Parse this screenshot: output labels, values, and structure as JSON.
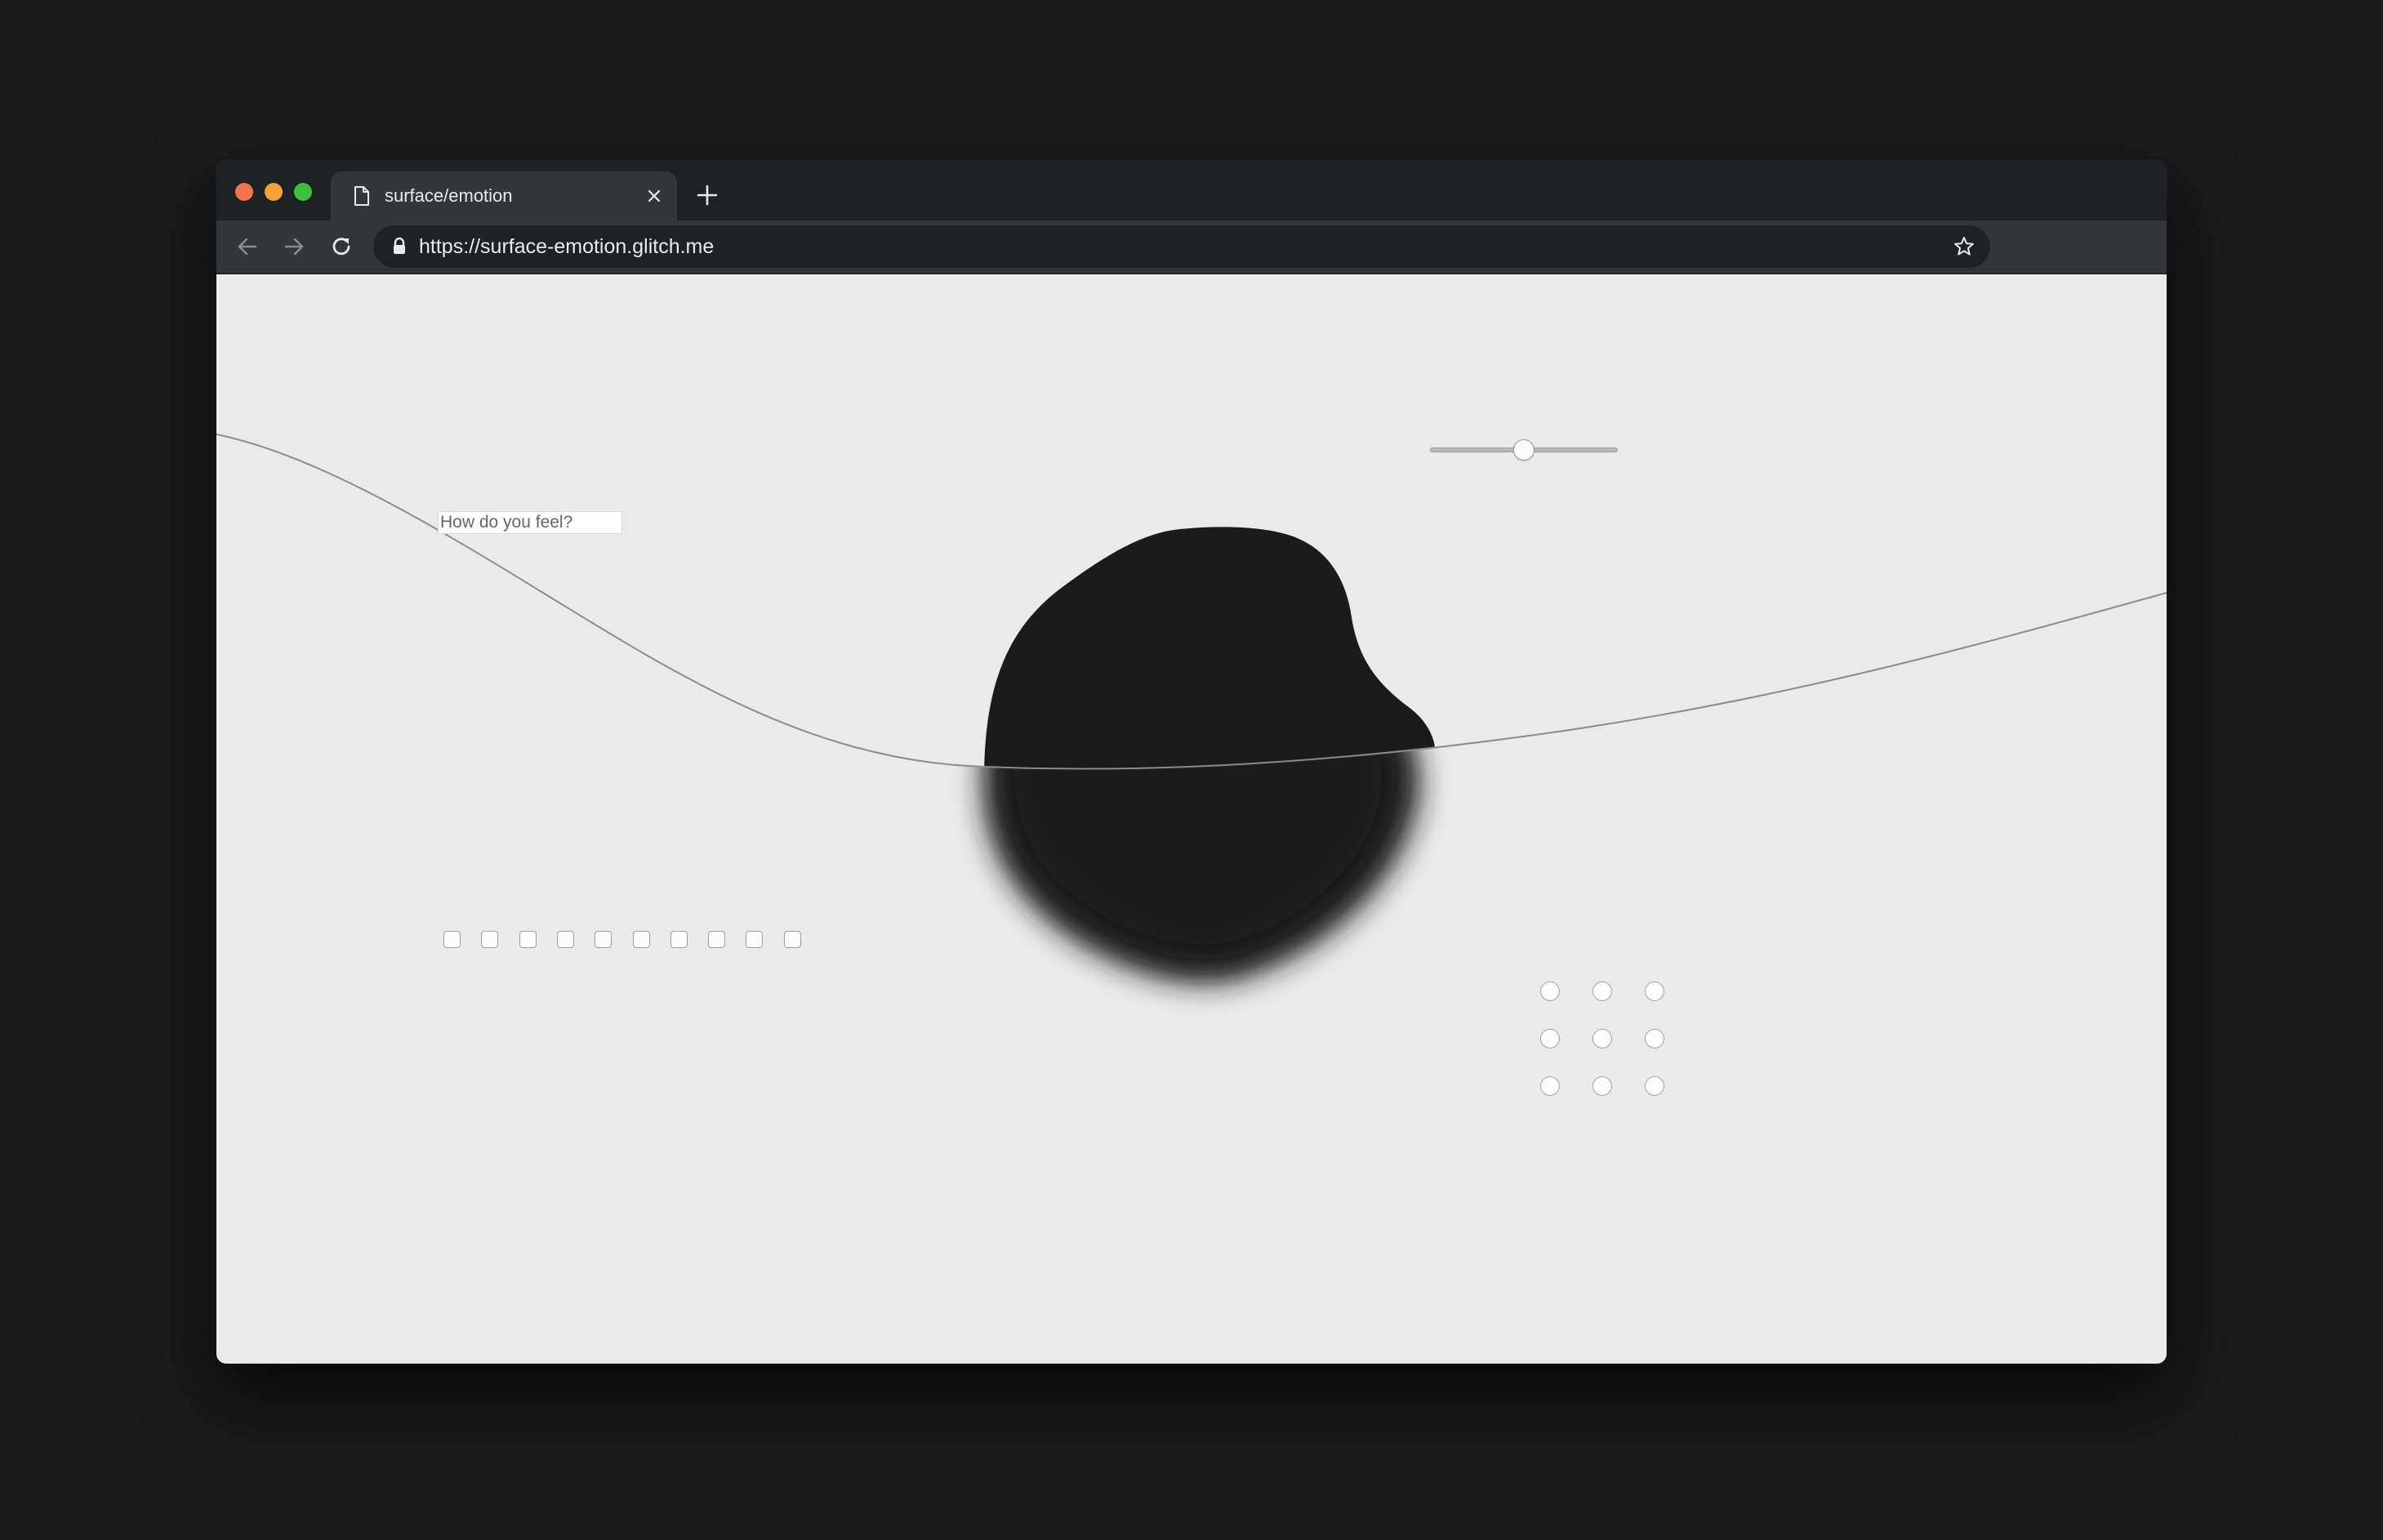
{
  "browser": {
    "tab": {
      "title": "surface/emotion",
      "icon": "document-icon"
    },
    "url": "https://surface-emotion.glitch.me",
    "colors": {
      "close": "#f0764f",
      "minimize": "#f2a33a",
      "maximize": "#3dbe3f",
      "chrome_dark": "#202124",
      "chrome_toolbar": "#35363a"
    }
  },
  "page": {
    "background": "#eaeaea",
    "blob_color": "#1b1b1b",
    "feel_input": {
      "placeholder": "How do you feel?",
      "value": ""
    },
    "slider": {
      "value": 50,
      "min": 0,
      "max": 100
    },
    "checkboxes": [
      false,
      false,
      false,
      false,
      false,
      false,
      false,
      false,
      false,
      false
    ],
    "radio_grid": {
      "rows": 3,
      "cols": 3,
      "selected": null
    }
  }
}
